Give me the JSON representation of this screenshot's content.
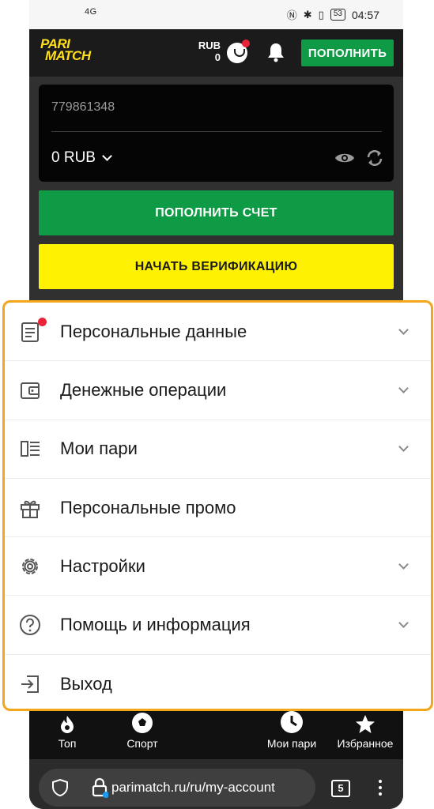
{
  "status_bar": {
    "network": "4G",
    "battery": "53",
    "time": "04:57"
  },
  "header": {
    "logo_line1": "PARI",
    "logo_line2": "MATCH",
    "currency": "RUB",
    "balance": "0",
    "topup_label": "ПОПОЛНИТЬ"
  },
  "account": {
    "id": "779861348",
    "balance": "0 RUB"
  },
  "buttons": {
    "deposit": "ПОПОЛНИТЬ СЧЕТ",
    "verify": "НАЧАТЬ ВЕРИФИКАЦИЮ"
  },
  "menu": {
    "items": [
      {
        "label": "Персональные данные",
        "icon": "document-icon",
        "expandable": true,
        "notification": true
      },
      {
        "label": "Денежные операции",
        "icon": "wallet-icon",
        "expandable": true
      },
      {
        "label": "Мои пари",
        "icon": "bets-list-icon",
        "expandable": true
      },
      {
        "label": "Персональные промо",
        "icon": "gift-icon",
        "expandable": false
      },
      {
        "label": "Настройки",
        "icon": "gear-icon",
        "expandable": true
      },
      {
        "label": "Помощь и информация",
        "icon": "help-icon",
        "expandable": true
      },
      {
        "label": "Выход",
        "icon": "logout-icon",
        "expandable": false
      }
    ]
  },
  "bottom_nav": {
    "items": [
      {
        "label": "Топ",
        "icon": "fire-icon"
      },
      {
        "label": "Спорт",
        "icon": "soccer-ball-icon"
      },
      {
        "label": "Мои пари",
        "icon": "clock-icon"
      },
      {
        "label": "Избранное",
        "icon": "star-icon"
      }
    ]
  },
  "browser": {
    "url": "parimatch.ru/ru/my-account",
    "tab_count": "5"
  },
  "colors": {
    "brand_yellow": "#fff200",
    "brand_green": "#0f9b45",
    "highlight_border": "#f3a61a",
    "notification_red": "#e8243a"
  }
}
